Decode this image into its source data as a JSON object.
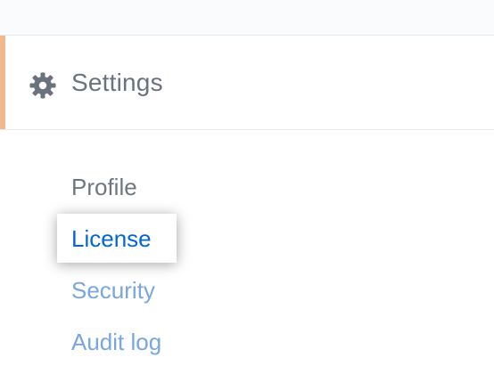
{
  "header": {
    "title": "Settings",
    "icon": "gear-icon"
  },
  "nav": {
    "items": [
      {
        "label": "Profile",
        "state": "heading"
      },
      {
        "label": "License",
        "state": "active"
      },
      {
        "label": "Security",
        "state": "link"
      },
      {
        "label": "Audit log",
        "state": "link"
      }
    ]
  },
  "colors": {
    "accent": "#f2b88e",
    "heading_text": "#6a737d",
    "active_link": "#0366d6",
    "link": "#79a6e0"
  }
}
